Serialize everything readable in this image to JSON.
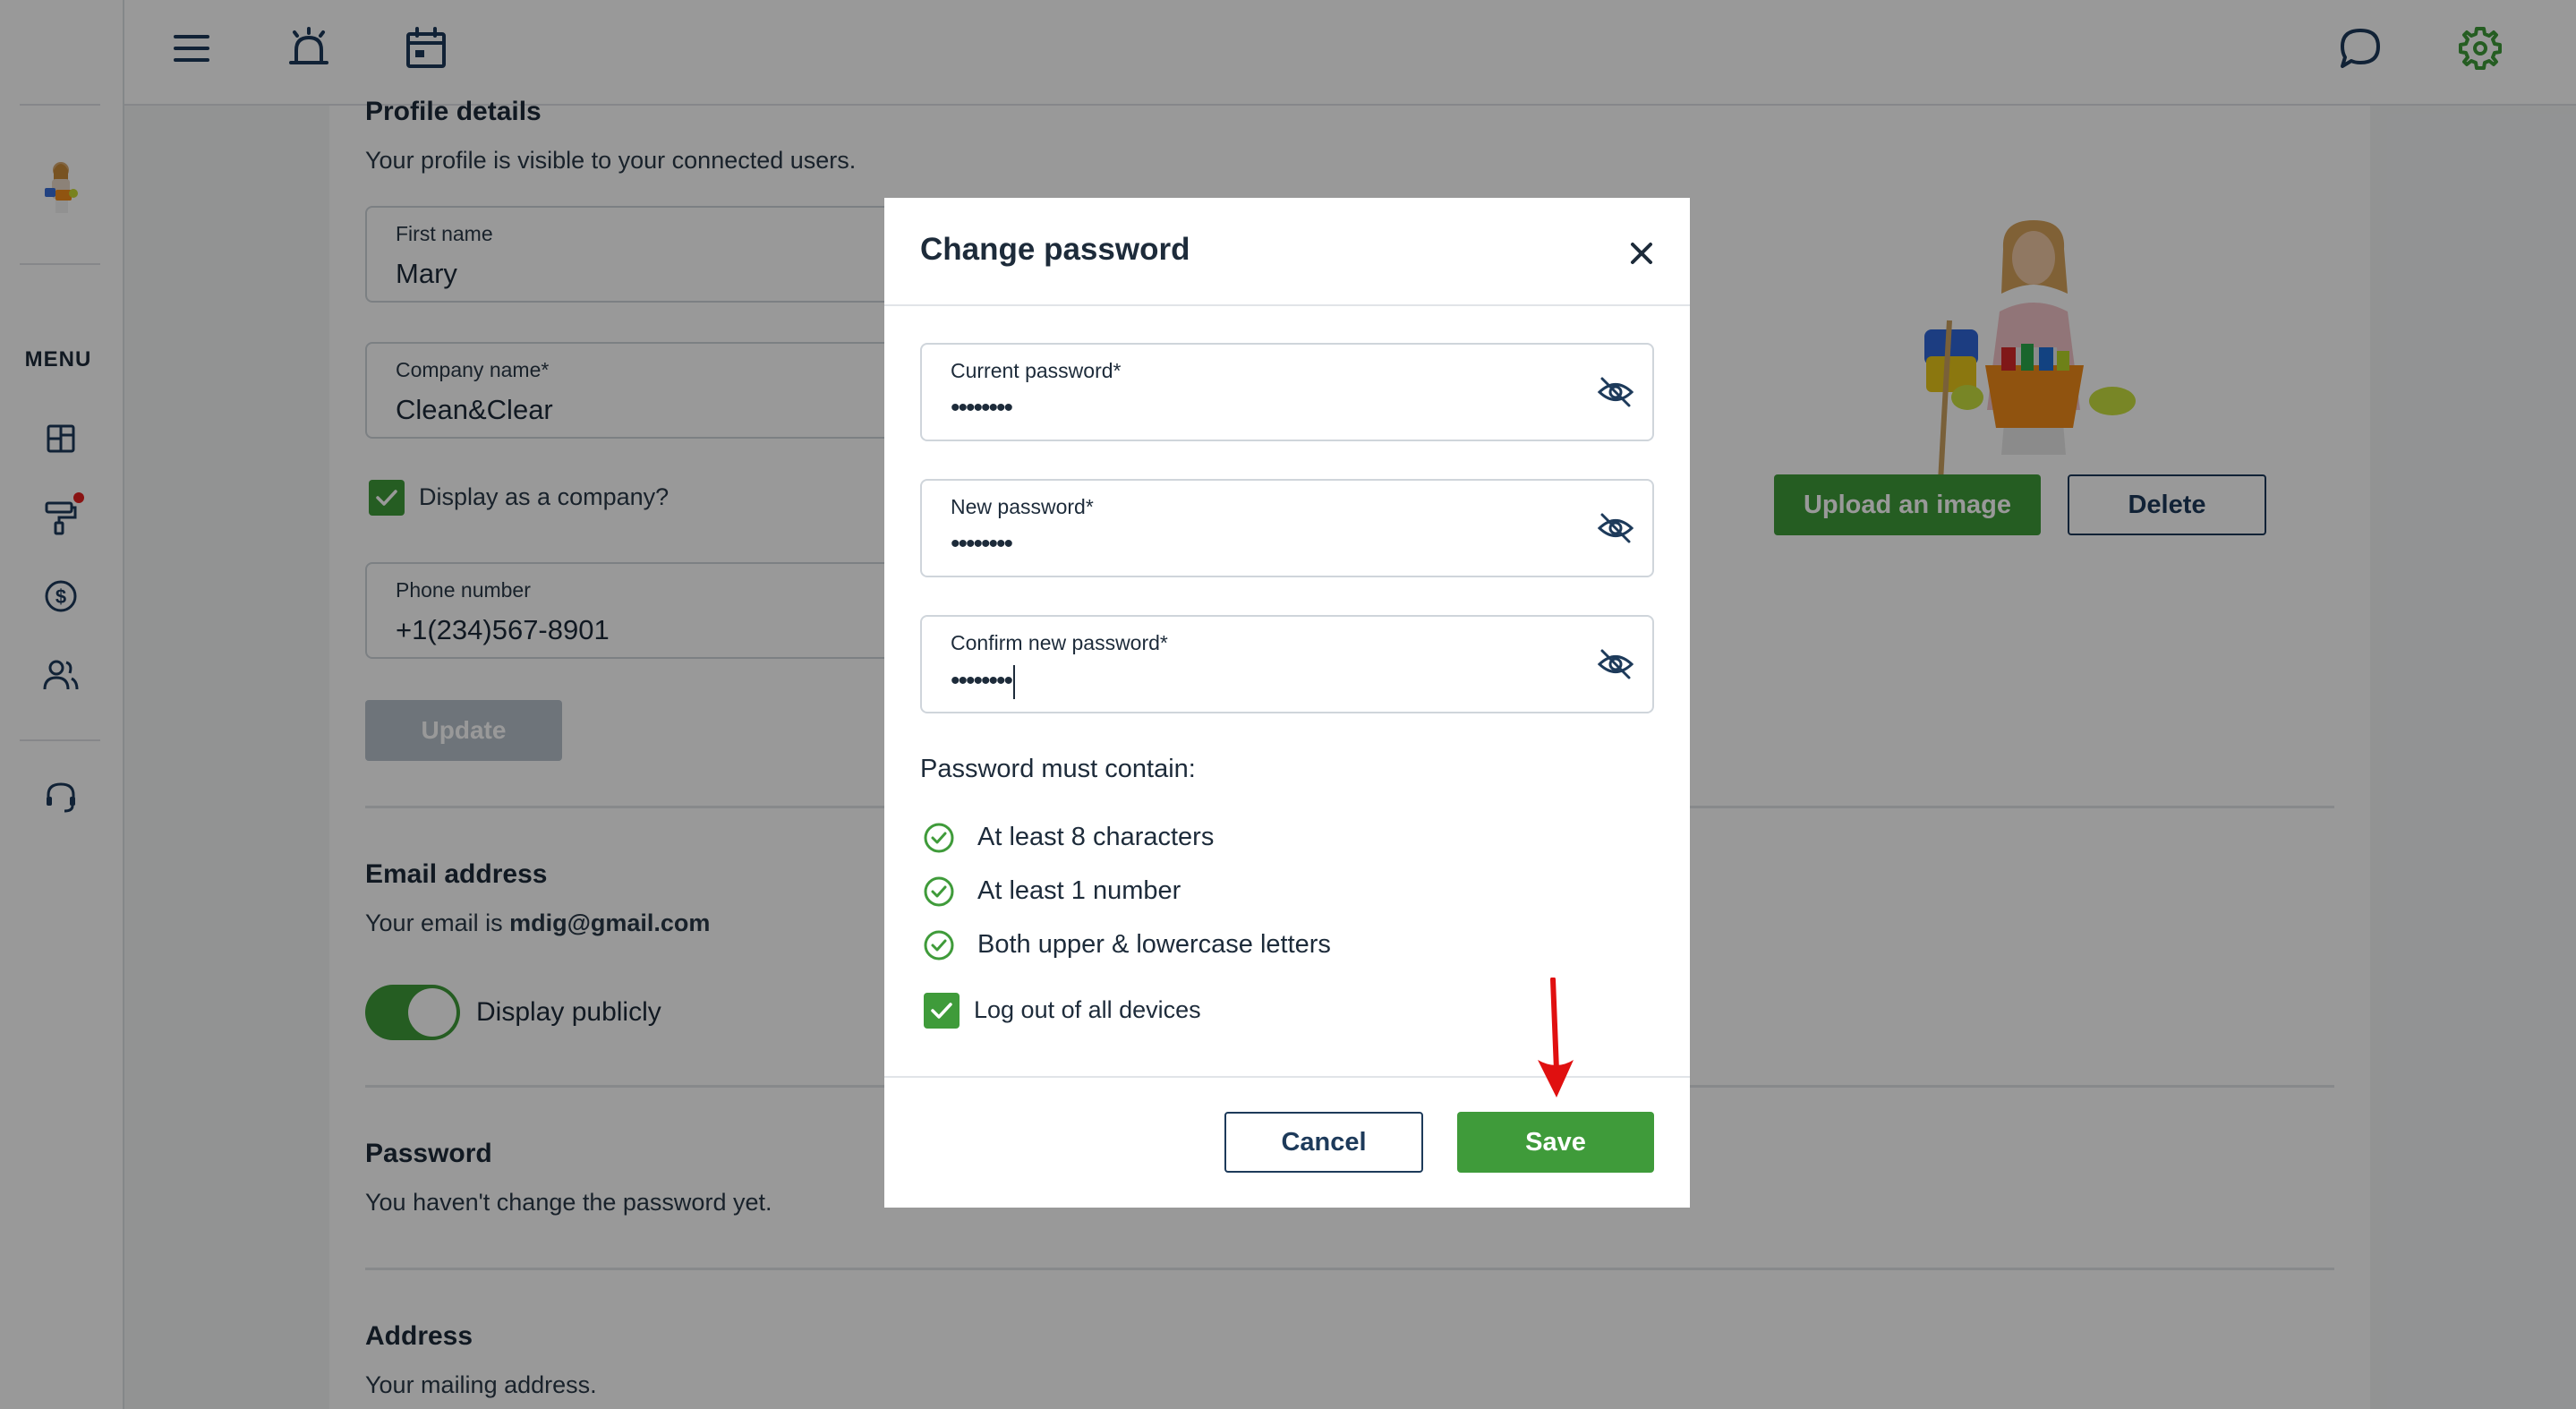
{
  "sidebar": {
    "menu_label": "MENU",
    "icons": [
      "dashboard-icon",
      "paint-roller-icon",
      "dollar-icon",
      "users-icon",
      "support-headset-icon"
    ]
  },
  "topbar": {
    "icons": [
      "hamburger-icon",
      "alarm-icon",
      "calendar-icon",
      "chat-icon",
      "settings-gear-icon"
    ]
  },
  "profile": {
    "title": "Profile details",
    "subtitle": "Your profile is visible to your connected users.",
    "first_name_label": "First name",
    "first_name_value": "Mary",
    "company_label": "Company name*",
    "company_value": "Clean&Clear",
    "display_company_label": "Display as a company?",
    "display_company_checked": true,
    "phone_label": "Phone number",
    "phone_value": "+1(234)567-8901",
    "update_label": "Update",
    "upload_label": "Upload an image",
    "delete_label": "Delete"
  },
  "email": {
    "title": "Email address",
    "prefix": "Your email is ",
    "address": "mdig@gmail.com",
    "display_publicly_label": "Display publicly",
    "display_publicly_on": true
  },
  "password": {
    "title": "Password",
    "subtitle": "You haven't change the password yet."
  },
  "address": {
    "title": "Address",
    "subtitle": "Your mailing address."
  },
  "modal": {
    "title": "Change password",
    "current_label": "Current password*",
    "current_value": "••••••••",
    "new_label": "New password*",
    "new_value": "••••••••",
    "confirm_label": "Confirm new password*",
    "confirm_value": "••••••••",
    "requirements_title": "Password must contain:",
    "requirements": [
      "At least 8 characters",
      "At least 1 number",
      "Both upper & lowercase letters"
    ],
    "logout_label": "Log out of all devices",
    "logout_checked": true,
    "cancel_label": "Cancel",
    "save_label": "Save"
  },
  "colors": {
    "accent_green": "#3f9b3a",
    "navy": "#1d3a5a",
    "annotation_red": "#e01010"
  }
}
